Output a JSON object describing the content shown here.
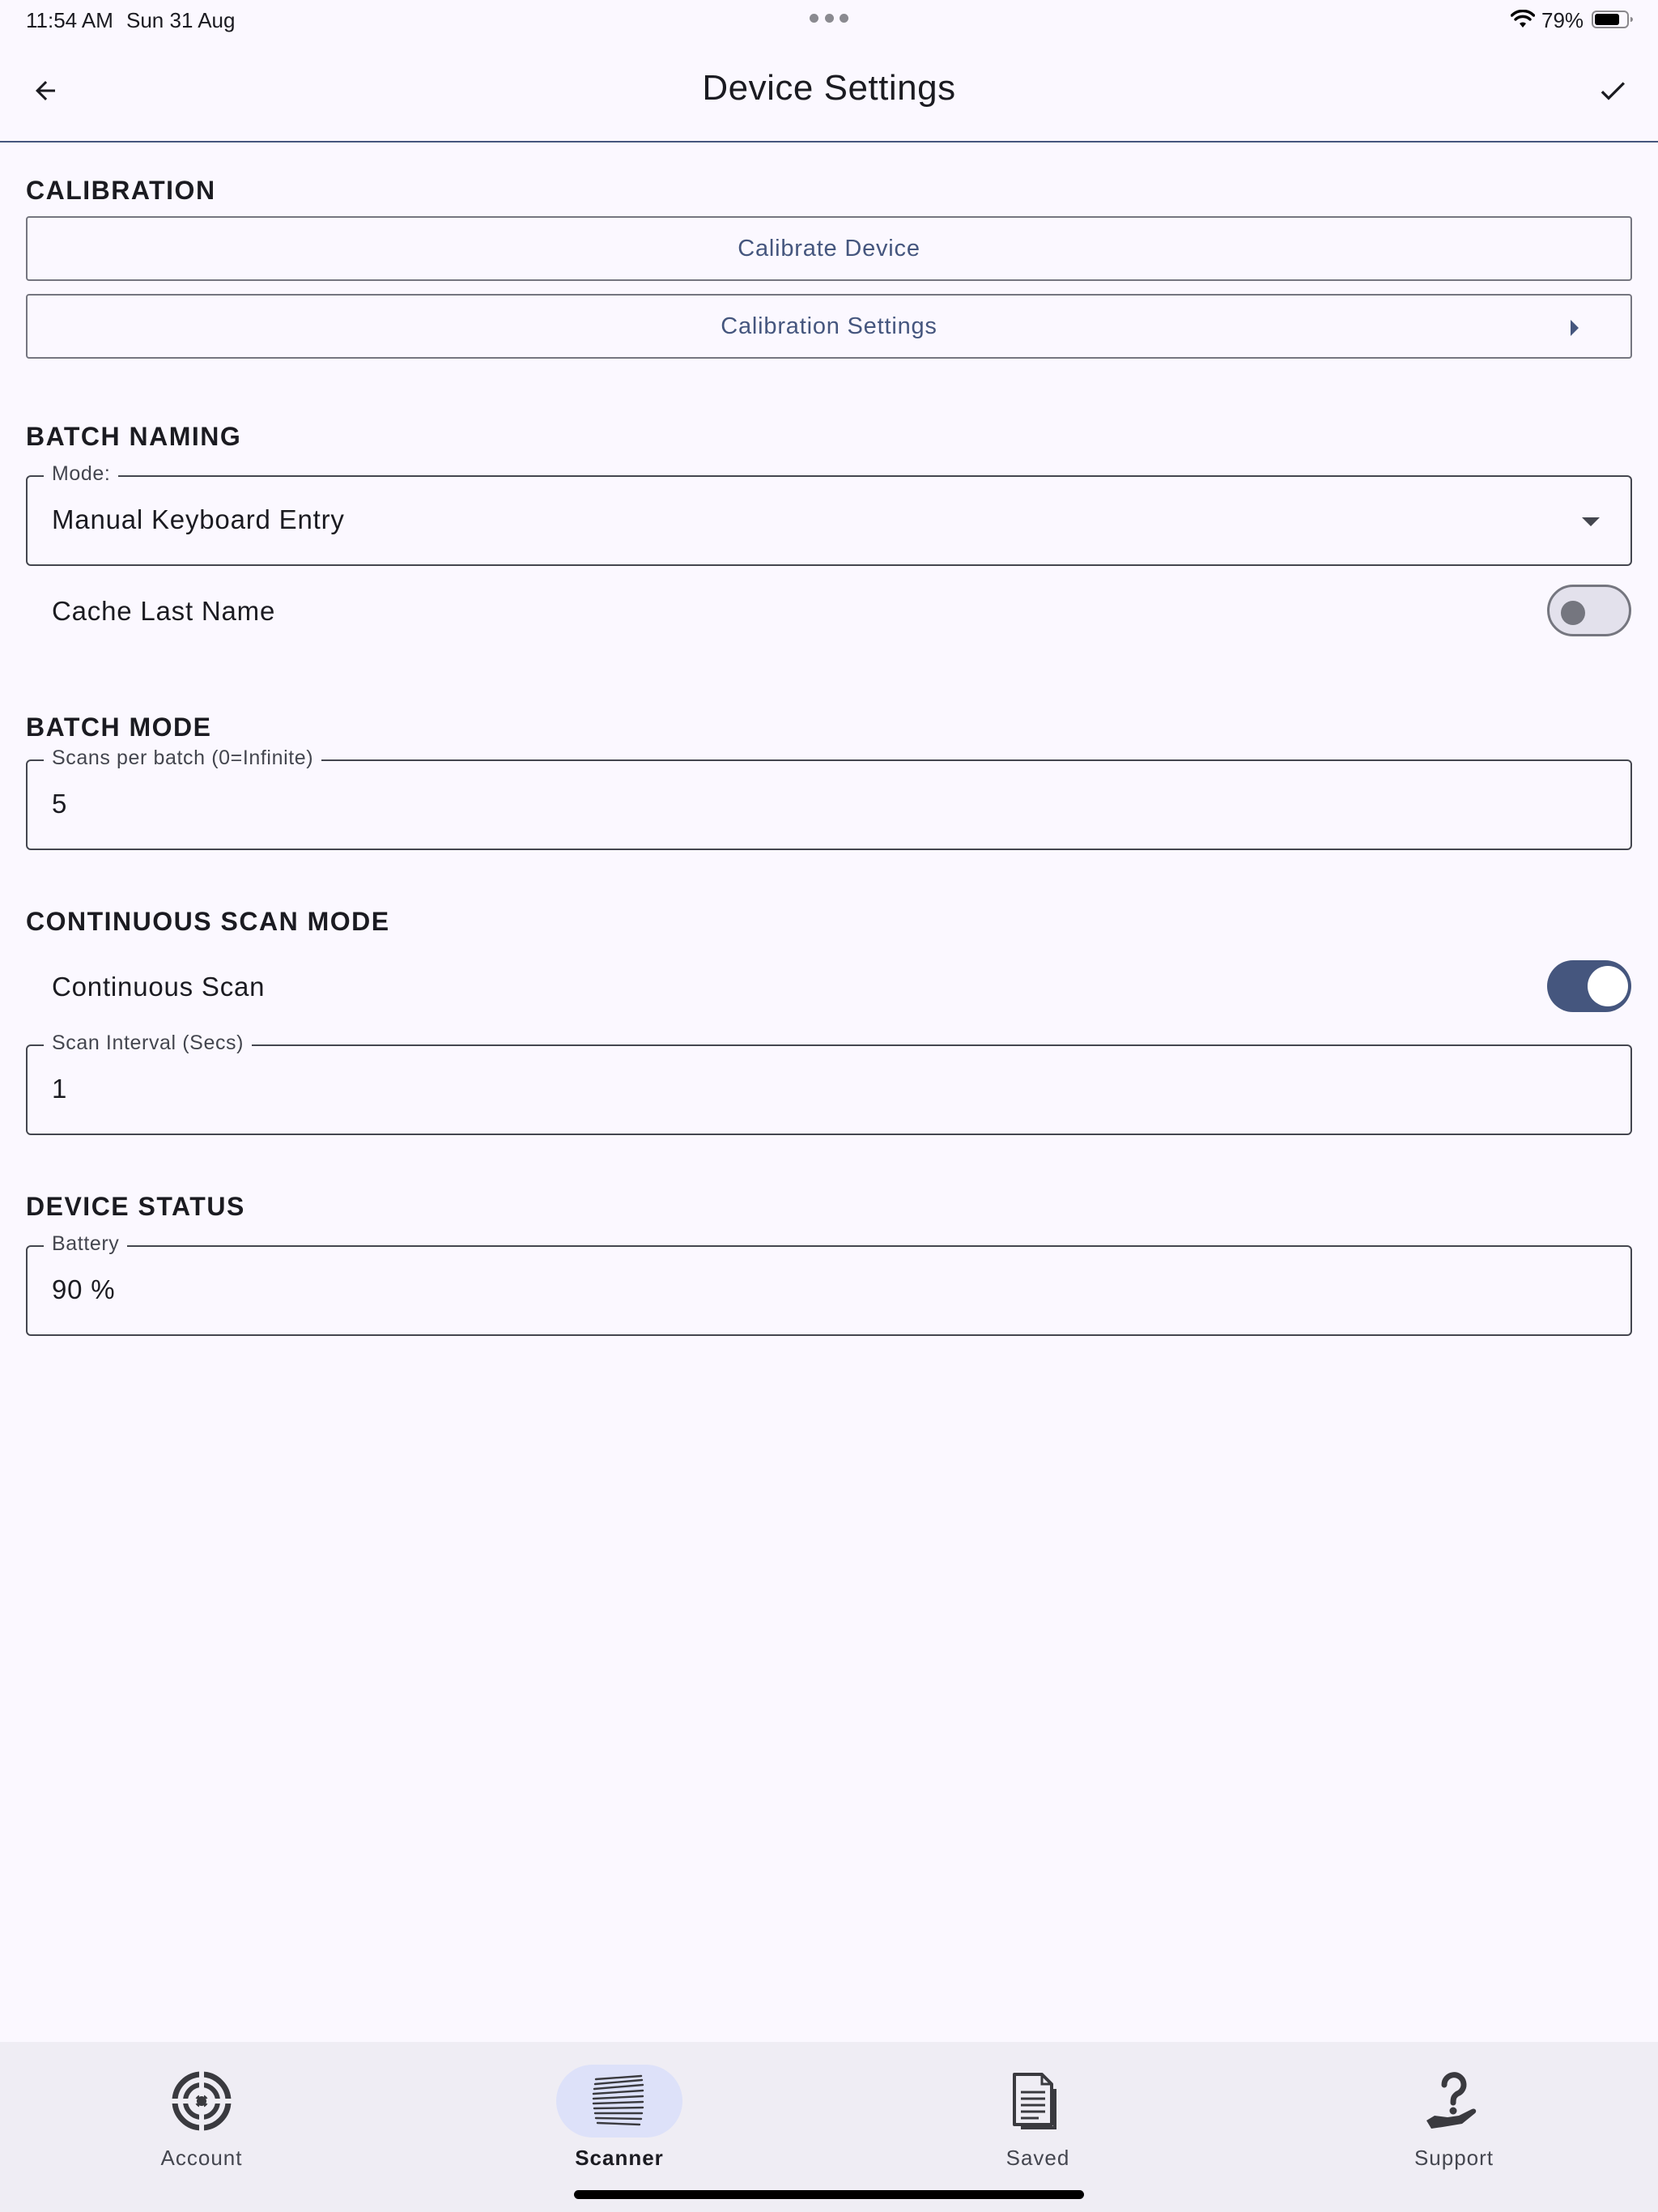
{
  "status_bar": {
    "time": "11:54 AM",
    "date": "Sun 31 Aug",
    "battery_percent": "79%",
    "battery_level": 0.79
  },
  "header": {
    "title": "Device Settings",
    "back_icon": "arrow-left-icon",
    "confirm_icon": "check-icon"
  },
  "calibration": {
    "section_title": "CALIBRATION",
    "calibrate_label": "Calibrate Device",
    "settings_label": "Calibration Settings"
  },
  "batch_naming": {
    "section_title": "BATCH NAMING",
    "mode_label": "Mode:",
    "mode_value": "Manual Keyboard Entry",
    "cache_label": "Cache Last Name",
    "cache_enabled": false
  },
  "batch_mode": {
    "section_title": "BATCH MODE",
    "scans_label": "Scans per batch (0=Infinite)",
    "scans_value": "5"
  },
  "continuous_scan": {
    "section_title": "CONTINUOUS SCAN MODE",
    "toggle_label": "Continuous Scan",
    "enabled": true,
    "interval_label": "Scan Interval (Secs)",
    "interval_value": "1"
  },
  "device_status": {
    "section_title": "DEVICE STATUS",
    "battery_label": "Battery",
    "battery_value": "90 %"
  },
  "bottom_nav": {
    "items": [
      {
        "label": "Account",
        "icon": "target-icon",
        "active": false
      },
      {
        "label": "Scanner",
        "icon": "scanner-icon",
        "active": true
      },
      {
        "label": "Saved",
        "icon": "document-icon",
        "active": false
      },
      {
        "label": "Support",
        "icon": "help-hand-icon",
        "active": false
      }
    ]
  },
  "colors": {
    "background": "#fbf8ff",
    "primary": "#45567e",
    "outline": "#44464f",
    "nav_background": "#efedf4",
    "active_indicator": "#dde1f9"
  }
}
